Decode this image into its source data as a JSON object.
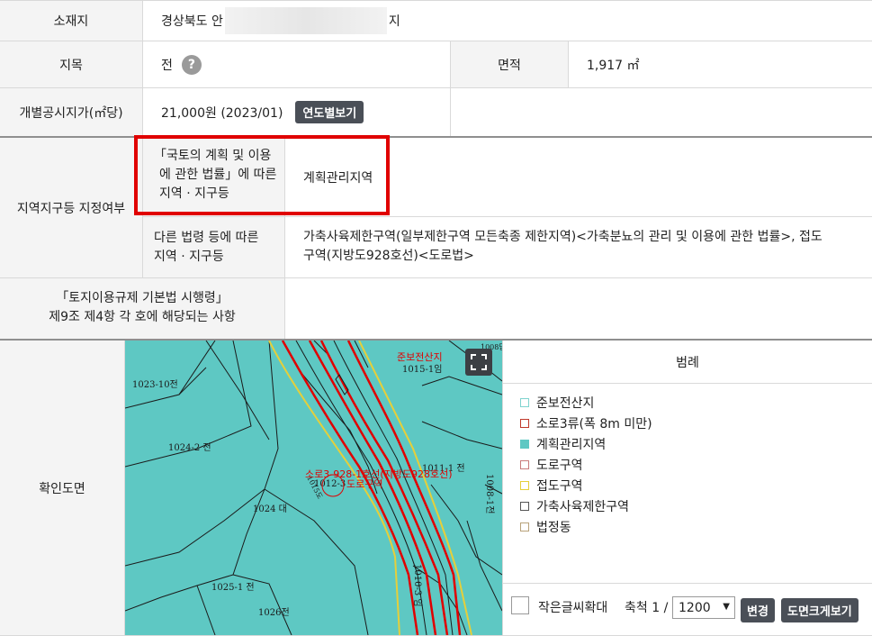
{
  "rows": {
    "location": {
      "label": "소재지",
      "value_prefix": "경상북도 안",
      "value_suffix": "지"
    },
    "land_category": {
      "label": "지목",
      "value": "전",
      "help": "?"
    },
    "area": {
      "label": "면적",
      "value": "1,917 ㎡"
    },
    "official_price": {
      "label": "개별공시지가(㎡당)",
      "value": "21,000원 (2023/01)",
      "button": "연도별보기"
    },
    "zoning": {
      "label": "지역지구등 지정여부",
      "national_label_l1": "「국토의 계획 및 이용",
      "national_label_l2": "에 관한 법률」에 따른",
      "national_label_l3": "지역 · 지구등",
      "national_value": "계획관리지역",
      "other_label_l1": "다른 법령 등에 따른",
      "other_label_l2": "지역 · 지구등",
      "other_value_l1": "가축사육제한구역(일부제한구역 모든축종 제한지역)<가축분뇨의 관리 및 이용에 관한 법률>, 접도",
      "other_value_l2": "구역(지방도928호선)<도로법>"
    },
    "enforcement": {
      "label_l1": "「토지이용규제 기본법 시행령」",
      "label_l2": "제9조 제4항 각 호에 해당되는 사항"
    },
    "map": {
      "label": "확인도면"
    }
  },
  "legend": {
    "title": "범례",
    "items": [
      {
        "label": "준보전산지",
        "color": "#7fd3cf",
        "fill": "none"
      },
      {
        "label": "소로3류(폭 8m 미만)",
        "color": "#c0392b",
        "fill": "none"
      },
      {
        "label": "계획관리지역",
        "color": "#5ec8c3",
        "fill": "#5ec8c3"
      },
      {
        "label": "도로구역",
        "color": "#c97b7b",
        "fill": "none"
      },
      {
        "label": "접도구역",
        "color": "#e6cf3a",
        "fill": "none"
      },
      {
        "label": "가축사육제한구역",
        "color": "#555555",
        "fill": "none"
      },
      {
        "label": "법정동",
        "color": "#b8a27a",
        "fill": "none"
      }
    ]
  },
  "controls": {
    "enlarge_text_label": "작은글씨확대",
    "scale_label": "축척 1 /",
    "scale_value": "1200",
    "change_button": "변경",
    "big_map_button": "도면크게보기"
  },
  "map_labels": {
    "parcel_1023": "1023-10전",
    "parcel_1024_2": "1024-2 전",
    "parcel_1024": "1024 대",
    "parcel_1025": "1025-1 전",
    "parcel_1026": "1026전",
    "parcel_1015": "1015-1임",
    "parcel_1008": "1008-1전",
    "parcel_1010": "1010-3 임",
    "parcel_1011": "1011-1 전",
    "parcel_1012": "1012-3",
    "red_forest": "준보전산지",
    "red_road": "소로3-928-1호선(지방도928호선)",
    "red_road_zone": "도로구역",
    "top_right": "1008답",
    "diag_label": "1015도"
  },
  "colors": {
    "map_fill": "#5ec8c3",
    "highlight": "#e00000",
    "header_bg": "#f4f4f4"
  }
}
